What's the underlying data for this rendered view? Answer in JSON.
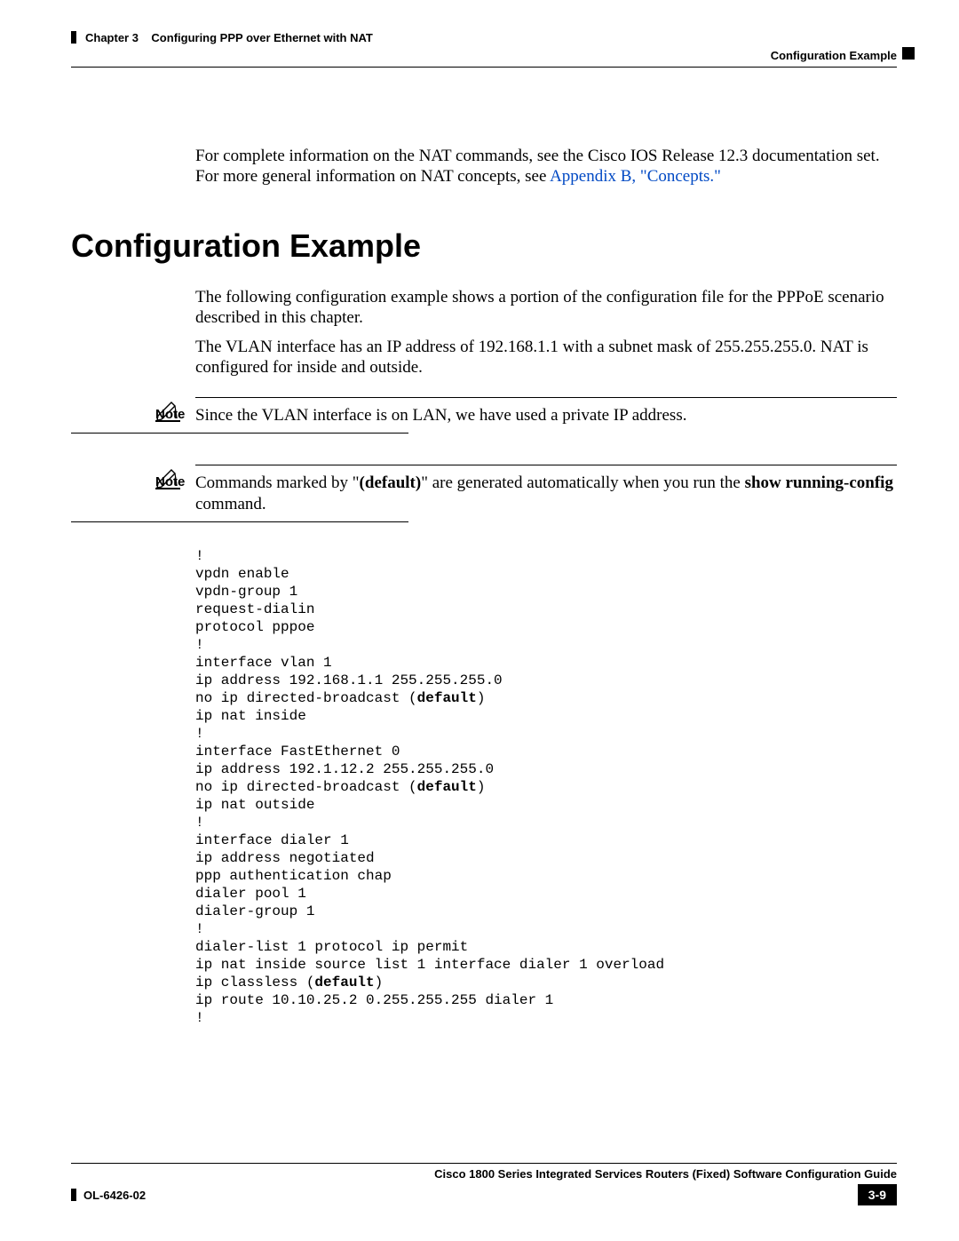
{
  "header": {
    "chapter_label": "Chapter 3",
    "chapter_title": "Configuring PPP over Ethernet with NAT",
    "section": "Configuration Example"
  },
  "intro": {
    "line1": "For complete information on the NAT commands, see the Cisco IOS Release 12.3 documentation set. For more general information on NAT concepts, see ",
    "link": "Appendix B, \"Concepts.\""
  },
  "section": {
    "title": "Configuration Example",
    "p1": "The following configuration example shows a portion of the configuration file for the PPPoE scenario described in this chapter.",
    "p2": "The VLAN interface has an IP address of 192.168.1.1 with a subnet mask of 255.255.255.0. NAT is configured for inside and outside."
  },
  "notes": {
    "label": "Note",
    "n1": "Since the VLAN interface is on LAN, we have used a private IP address.",
    "n2_pre": "Commands marked by \"",
    "n2_bold1": "(default)",
    "n2_mid": "\" are generated automatically when you run the ",
    "n2_bold2": "show running-config",
    "n2_post": " command."
  },
  "code": {
    "l1": "!",
    "l2": "vpdn enable",
    "l3": "vpdn-group 1",
    "l4": "request-dialin",
    "l5": "protocol pppoe",
    "l6": "!",
    "l7": "interface vlan 1",
    "l8": "ip address 192.168.1.1 255.255.255.0",
    "l9a": "no ip directed-broadcast (",
    "l9b": "default",
    "l9c": ")",
    "l10": "ip nat inside",
    "l11": "!",
    "l12": "interface FastEthernet 0",
    "l13": "ip address 192.1.12.2 255.255.255.0",
    "l14a": "no ip directed-broadcast (",
    "l14b": "default",
    "l14c": ")",
    "l15": "ip nat outside",
    "l16": "!",
    "l17": "interface dialer 1",
    "l18": "ip address negotiated",
    "l19": "ppp authentication chap",
    "l20": "dialer pool 1",
    "l21": "dialer-group 1",
    "l22": "!",
    "l23": "dialer-list 1 protocol ip permit",
    "l24": "ip nat inside source list 1 interface dialer 1 overload",
    "l25a": "ip classless (",
    "l25b": "default",
    "l25c": ")",
    "l26": "ip route 10.10.25.2 0.255.255.255 dialer 1",
    "l27": "!"
  },
  "footer": {
    "guide": "Cisco 1800 Series Integrated Services Routers (Fixed) Software Configuration Guide",
    "doc_id": "OL-6426-02",
    "page": "3-9"
  }
}
